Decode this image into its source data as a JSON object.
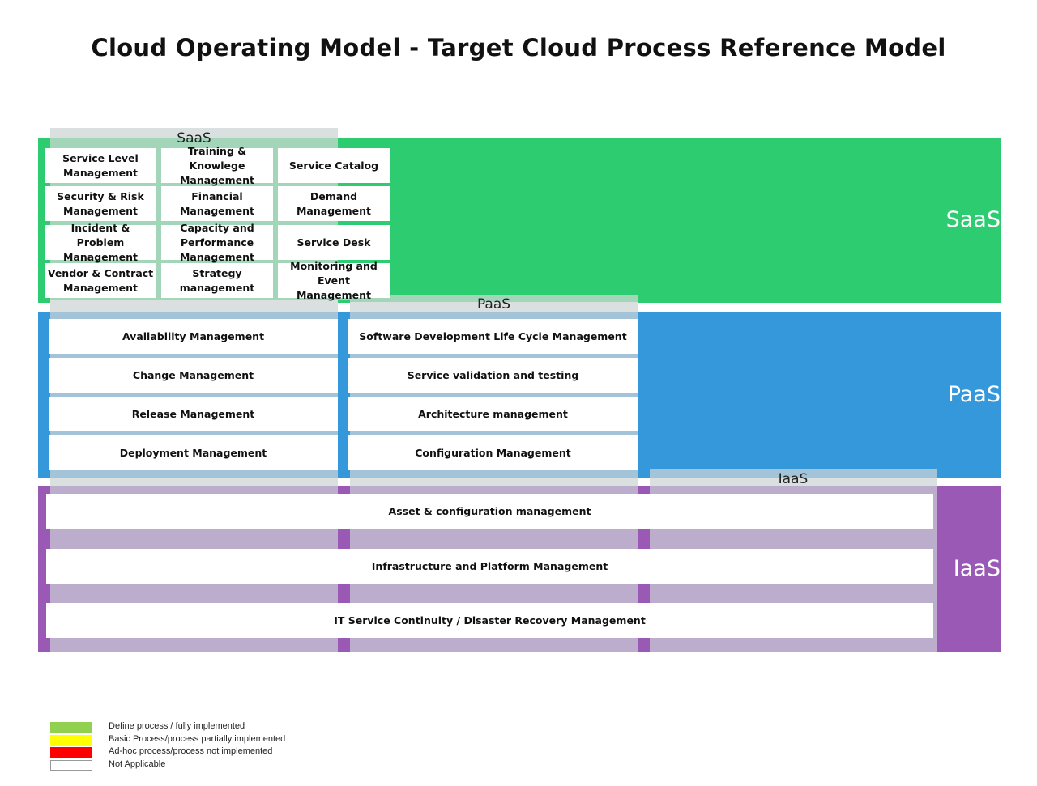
{
  "title": "Cloud Operating Model - Target Cloud Process Reference Model",
  "colors": {
    "saas": "#2ecc71",
    "paas": "#3498db",
    "iaas": "#9b59b6",
    "legend_green": "#92d050",
    "legend_yellow": "#ffff00",
    "legend_red": "#ff0000"
  },
  "bands": {
    "saas_label": "SaaS",
    "paas_label": "PaaS",
    "iaas_label": "IaaS"
  },
  "columns": {
    "saas_header": "SaaS",
    "paas_header": "PaaS",
    "iaas_header": "IaaS"
  },
  "saas_processes": [
    "Service Level Management",
    "Training & Knowlege Management",
    "Service Catalog",
    "Security & Risk Management",
    "Financial Management",
    "Demand Management",
    "Incident & Problem Management",
    "Capacity and Performance Management",
    "Service Desk",
    "Vendor  & Contract Management",
    "Strategy management",
    "Monitoring and Event Management"
  ],
  "paas_left_processes": [
    "Availability Management",
    "Change Management",
    "Release Management",
    "Deployment Management"
  ],
  "paas_right_processes": [
    "Software Development Life Cycle Management",
    "Service validation and testing",
    "Architecture management",
    "Configuration Management"
  ],
  "iaas_processes": [
    "Asset & configuration management",
    "Infrastructure and Platform Management",
    "IT Service Continuity / Disaster Recovery Management"
  ],
  "legend": [
    {
      "label": "Define process / fully implemented",
      "color": "#92d050"
    },
    {
      "label": "Basic Process/process partially implemented",
      "color": "#ffff00"
    },
    {
      "label": "Ad-hoc process/process not implemented",
      "color": "#ff0000"
    },
    {
      "label": "Not Applicable",
      "color": "#ffffff"
    }
  ]
}
